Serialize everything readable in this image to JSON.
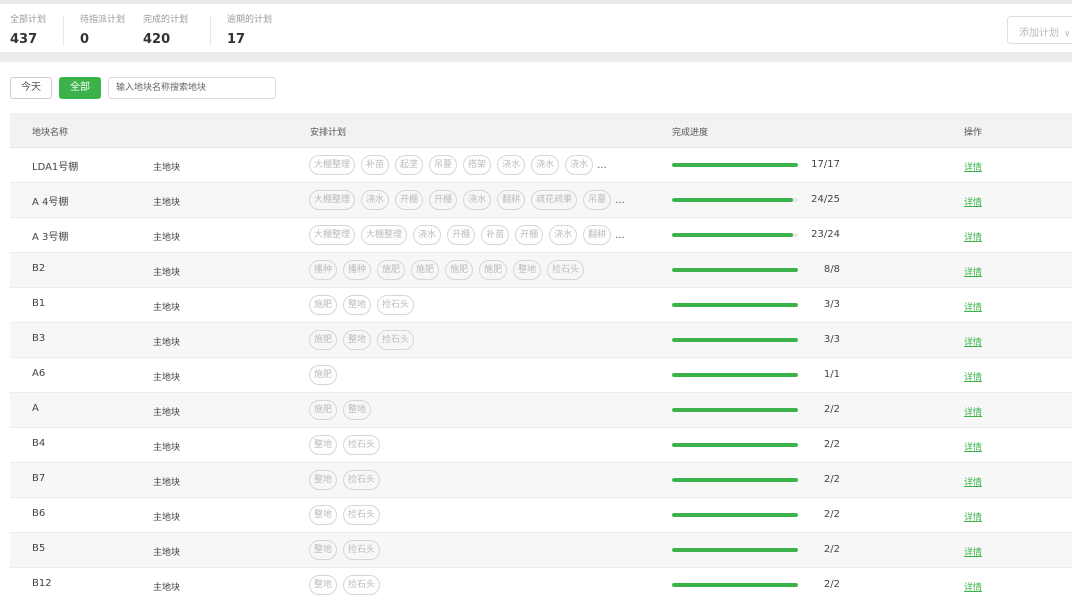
{
  "stats": [
    {
      "label": "全部计划",
      "value": "437"
    },
    {
      "label": "待指派计划",
      "value": "0"
    },
    {
      "label": "完成的计划",
      "value": "420"
    },
    {
      "label": "逾期的计划",
      "value": "17"
    }
  ],
  "add_plan": {
    "label": "添加计划",
    "icon": "chevron-down-icon"
  },
  "filters": {
    "today": "今天",
    "all": "全部",
    "search_placeholder": "输入地块名称搜索地块"
  },
  "table": {
    "headers": {
      "name": "地块名称",
      "plan": "安排计划",
      "progress": "完成进度",
      "action": "操作"
    },
    "detail_label": "详情",
    "more_label": "...",
    "accent": "#3bb34a",
    "rows": [
      {
        "name": "LDA1号棚",
        "type": "主地块",
        "tags": [
          "大棚整理",
          "补苗",
          "起垄",
          "吊蔓",
          "搭架",
          "浇水",
          "浇水",
          "浇水"
        ],
        "more": true,
        "progress_text": "17/17",
        "progress": 1.0
      },
      {
        "name": "A 4号棚",
        "type": "主地块",
        "tags": [
          "大棚整理",
          "浇水",
          "开棚",
          "开棚",
          "浇水",
          "翻耕",
          "疏花疏果",
          "吊蔓"
        ],
        "more": true,
        "progress_text": "24/25",
        "progress": 0.96
      },
      {
        "name": "A 3号棚",
        "type": "主地块",
        "tags": [
          "大棚整理",
          "大棚整理",
          "浇水",
          "开棚",
          "补苗",
          "开棚",
          "浇水",
          "翻耕"
        ],
        "more": true,
        "progress_text": "23/24",
        "progress": 0.958
      },
      {
        "name": "B2",
        "type": "主地块",
        "tags": [
          "播种",
          "播种",
          "施肥",
          "施肥",
          "施肥",
          "施肥",
          "整地",
          "捡石头"
        ],
        "more": false,
        "progress_text": "8/8",
        "progress": 1.0
      },
      {
        "name": "B1",
        "type": "主地块",
        "tags": [
          "施肥",
          "整地",
          "捡石头"
        ],
        "more": false,
        "progress_text": "3/3",
        "progress": 1.0
      },
      {
        "name": "B3",
        "type": "主地块",
        "tags": [
          "施肥",
          "整地",
          "捡石头"
        ],
        "more": false,
        "progress_text": "3/3",
        "progress": 1.0
      },
      {
        "name": "A6",
        "type": "主地块",
        "tags": [
          "施肥"
        ],
        "more": false,
        "progress_text": "1/1",
        "progress": 1.0
      },
      {
        "name": "A",
        "type": "主地块",
        "tags": [
          "施肥",
          "整地"
        ],
        "more": false,
        "progress_text": "2/2",
        "progress": 1.0
      },
      {
        "name": "B4",
        "type": "主地块",
        "tags": [
          "整地",
          "捡石头"
        ],
        "more": false,
        "progress_text": "2/2",
        "progress": 1.0
      },
      {
        "name": "B7",
        "type": "主地块",
        "tags": [
          "整地",
          "捡石头"
        ],
        "more": false,
        "progress_text": "2/2",
        "progress": 1.0
      },
      {
        "name": "B6",
        "type": "主地块",
        "tags": [
          "整地",
          "捡石头"
        ],
        "more": false,
        "progress_text": "2/2",
        "progress": 1.0
      },
      {
        "name": "B5",
        "type": "主地块",
        "tags": [
          "整地",
          "捡石头"
        ],
        "more": false,
        "progress_text": "2/2",
        "progress": 1.0
      },
      {
        "name": "B12",
        "type": "主地块",
        "tags": [
          "整地",
          "捡石头"
        ],
        "more": false,
        "progress_text": "2/2",
        "progress": 1.0
      }
    ]
  }
}
